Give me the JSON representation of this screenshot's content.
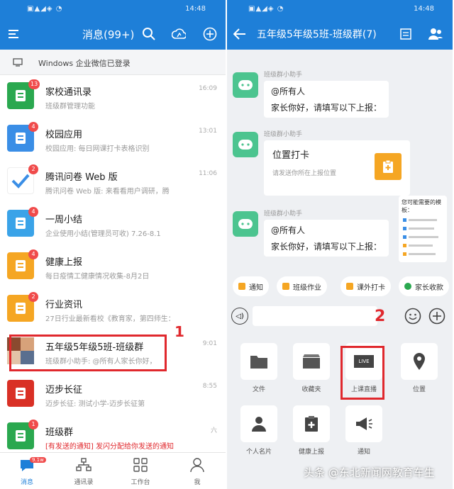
{
  "colors": {
    "primary": "#1e7fd8",
    "alert_red": "#e0282d",
    "badge": "#f04b4b"
  },
  "left": {
    "status_time": "14:48",
    "title": "消息(99+)",
    "notice": "Windows 企业微信已登录",
    "chats": [
      {
        "title": "家校通讯录",
        "subtitle": "班级群管理功能",
        "time": "16:09",
        "badge": "13",
        "icon": "contacts-icon",
        "color": "#2aa84f"
      },
      {
        "title": "校园应用",
        "subtitle": "校园应用: 每日网课打卡表格识别",
        "time": "13:01",
        "badge": "4",
        "icon": "apps-icon",
        "color": "#3a8ee6"
      },
      {
        "title": "腾讯问卷 Web 版",
        "subtitle": "腾讯问卷 Web 版: 来看看用户调研，腾",
        "time": "11:06",
        "badge": "2",
        "icon": "check-icon",
        "color": "#ffffff"
      },
      {
        "title": "一周小结",
        "subtitle": "企业使用小结(管理员可收) 7.26-8.1",
        "time": "",
        "badge": "4",
        "icon": "report-icon",
        "color": "#3aa3e8"
      },
      {
        "title": "健康上报",
        "subtitle": "每日疫情工健康情况收集-8月2日",
        "time": "",
        "badge": "4",
        "icon": "health-icon",
        "color": "#f5a623"
      },
      {
        "title": "行业资讯",
        "subtitle": "27日行业最新看校《教育家，第四师生：",
        "time": "",
        "badge": "2",
        "icon": "news-icon",
        "color": "#f5a623"
      },
      {
        "title": "五年级5年级5班-班级群",
        "subtitle": "班级群小助手: @所有人家长你好，",
        "time": "9:01",
        "badge": "",
        "icon": "class-group-avatar",
        "color": "#c44a3a"
      },
      {
        "title": "迈步长征",
        "subtitle": "迈步长征: 测试小学-迈步长征第",
        "time": "8:55",
        "badge": "",
        "icon": "book-icon",
        "color": "#d93025"
      },
      {
        "title": "班级群",
        "subtitle": "[有发送的通知] 发闪分配给你发送的通知",
        "time": "六",
        "badge": "1",
        "icon": "group-icon",
        "color": "#2aa84f"
      }
    ],
    "annotation": "1",
    "nav": [
      "消息",
      "通讯录",
      "工作台",
      "我"
    ],
    "nav_badge": "9.1w"
  },
  "right": {
    "status_time": "14:48",
    "title": "五年级5年级5班-班级群(7)",
    "sender": "班级群小助手",
    "messages": [
      {
        "line1": "@所有人",
        "line2": "家长你好，请填写以下上报："
      },
      {
        "line1": "位置打卡",
        "line2": "请发送你所在上报位置"
      },
      {
        "line1": "@所有人",
        "line2": "家长你好，请填写以下上报："
      }
    ],
    "side_card": "您可能需要的模板：",
    "quick_actions": [
      "通知",
      "班级作业",
      "课外打卡",
      "家长收款"
    ],
    "annotation": "2",
    "tools": [
      "文件",
      "收藏夹",
      "上课直播",
      "位置",
      "个人名片",
      "健康上报",
      "通知"
    ],
    "live_label": "LIVE"
  },
  "watermark": "头条 @东北新闻网教育车生"
}
